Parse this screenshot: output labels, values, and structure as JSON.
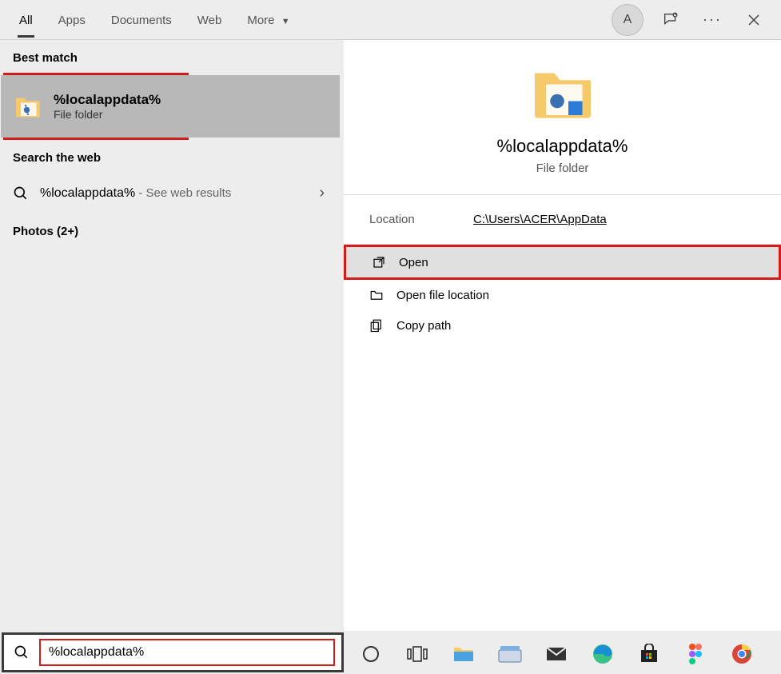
{
  "tabs": {
    "all": "All",
    "apps": "Apps",
    "documents": "Documents",
    "web": "Web",
    "more": "More"
  },
  "avatar_letter": "A",
  "left_panel": {
    "best_match_label": "Best match",
    "best_match_title": "%localappdata%",
    "best_match_subtitle": "File folder",
    "search_web_label": "Search the web",
    "web_query": "%localappdata%",
    "web_suffix": " - See web results",
    "photos_label": "Photos (2+)"
  },
  "preview": {
    "title": "%localappdata%",
    "subtitle": "File folder",
    "location_label": "Location",
    "location_path": "C:\\Users\\ACER\\AppData",
    "actions": {
      "open": "Open",
      "open_file_location": "Open file location",
      "copy_path": "Copy path"
    }
  },
  "search": {
    "value": "%localappdata%"
  }
}
